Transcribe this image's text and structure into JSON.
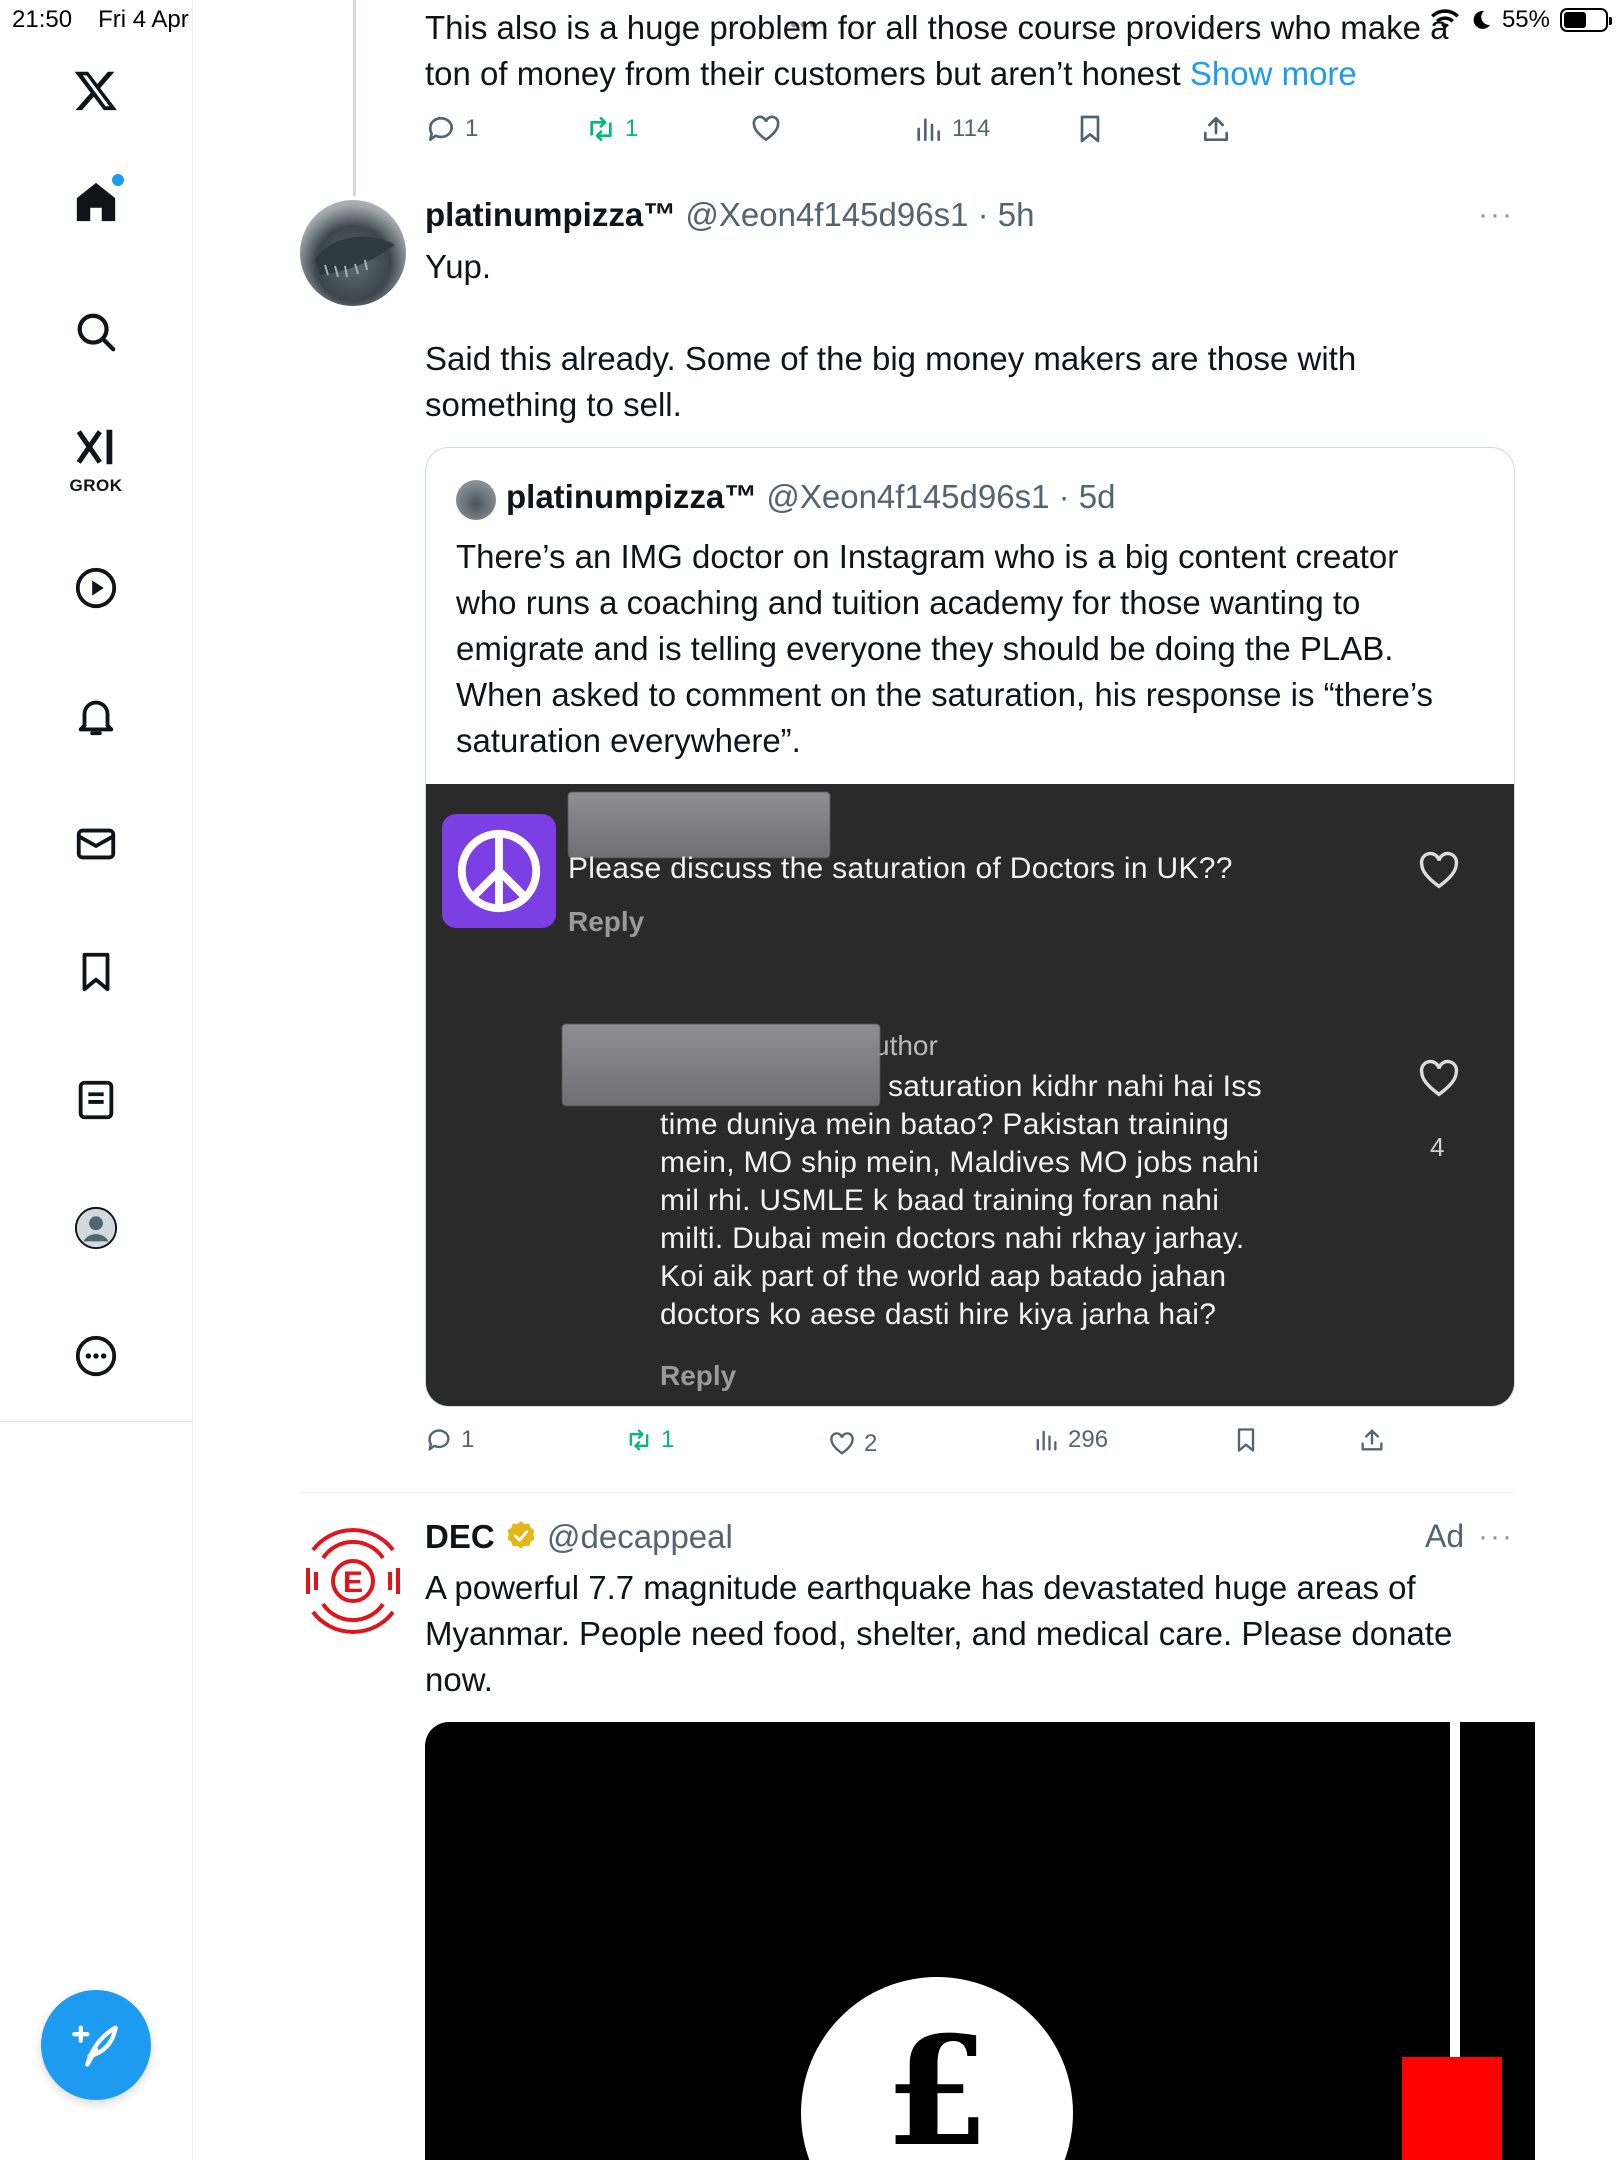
{
  "status_bar": {
    "time": "21:50",
    "date": "Fri 4 Apr",
    "battery": "55%",
    "battery_level": 0.55
  },
  "sidebar": {
    "logo": "x-logo-icon",
    "items": [
      {
        "name": "home",
        "icon": "home-icon",
        "has_dot": true
      },
      {
        "name": "search",
        "icon": "search-icon"
      },
      {
        "name": "grok",
        "icon": "grok-icon",
        "label": "GROK"
      },
      {
        "name": "video",
        "icon": "play-icon"
      },
      {
        "name": "notifications",
        "icon": "bell-icon"
      },
      {
        "name": "messages",
        "icon": "mail-icon"
      },
      {
        "name": "bookmarks",
        "icon": "bookmark-icon"
      },
      {
        "name": "lists",
        "icon": "list-icon"
      },
      {
        "name": "profile",
        "icon": "profile-icon"
      },
      {
        "name": "more",
        "icon": "more-icon"
      }
    ],
    "compose_icon": "compose-icon"
  },
  "tweet1": {
    "text_line1": "This also is a huge problem for all those course providers who make a",
    "text_line2": "ton of money from their customers but aren’t honest",
    "show_more": "Show more",
    "replies": "1",
    "retweets": "1",
    "views": "114"
  },
  "tweet2": {
    "name": "platinumpizza™",
    "handle": "@Xeon4f145d96s1",
    "time": "5h",
    "text_p1": "Yup.",
    "text_p2_line1": "Said this already. Some of the big money makers are those with",
    "text_p2_line2": "something to sell.",
    "quote": {
      "name": "platinumpizza™",
      "handle": "@Xeon4f145d96s1",
      "time": "5d",
      "lines": [
        "There’s an IMG doctor on Instagram who is a big content creator",
        "who runs a coaching and tuition academy for those wanting to",
        "emigrate and is telling everyone they should be doing the PLAB.",
        "When asked to comment on the saturation, his response is “there’s",
        "saturation everywhere”."
      ],
      "screenshot": {
        "comment1": "Please discuss the saturation of Doctors in UK??",
        "comment1_reply": "Reply",
        "author_fragment": "uthor",
        "reply_lines": [
          "saturation kidhr nahi hai Iss",
          "time duniya mein batao? Pakistan training",
          "mein, MO ship mein, Maldives MO jobs nahi",
          "mil rhi. USMLE k baad training foran nahi",
          "milti. Dubai mein doctors nahi rkhay jarhay.",
          "Koi aik part of the world aap batado jahan",
          "doctors ko aese dasti hire kiya jarha hai?"
        ],
        "reply_likes": "4",
        "reply_reply": "Reply"
      }
    },
    "replies": "1",
    "retweets": "1",
    "likes": "2",
    "views": "296"
  },
  "ad": {
    "name": "DEC",
    "handle": "@decappeal",
    "ad_label": "Ad",
    "text_line1": "A powerful 7.7 magnitude earthquake has devastated huge areas of",
    "text_line2": "Myanmar. People need food, shelter, and medical care. Please donate",
    "text_line3": "now.",
    "media_symbol": "£"
  }
}
